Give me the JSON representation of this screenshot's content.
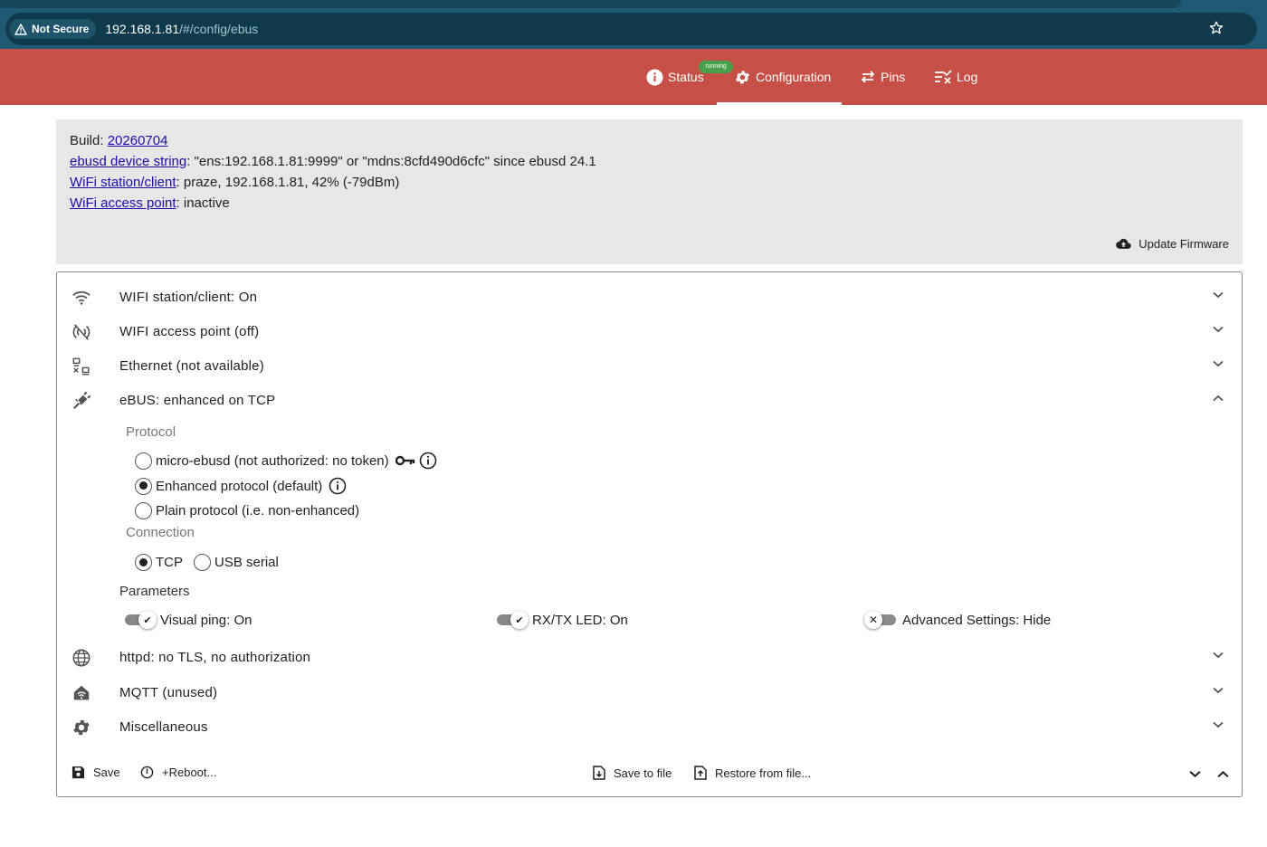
{
  "browser": {
    "not_secure": "Not Secure",
    "url_host": "192.168.1.81",
    "url_path": "/#/config/ebus"
  },
  "nav": {
    "status": "Status",
    "running_badge": "running",
    "configuration": "Configuration",
    "pins": "Pins",
    "log": "Log"
  },
  "info": {
    "build_label": "Build: ",
    "build_link": "20260704",
    "device_link": "ebusd device string",
    "device_text": ": \"ens:192.168.1.81:9999\" or \"mdns:8cfd490d6cfc\" since ebusd 24.1",
    "wifi_sta_link": "WiFi station/client",
    "wifi_sta_text": ": praze, 192.168.1.81, 42% (-79dBm)",
    "wifi_ap_link": "WiFi access point",
    "wifi_ap_text": ": inactive",
    "update_firmware": "Update Firmware"
  },
  "sections": {
    "wifi_station": "WIFI station/client: On",
    "wifi_ap": "WIFI access point (off)",
    "ethernet": "Ethernet (not available)",
    "ebus": "eBUS: enhanced on TCP",
    "httpd": "httpd: no TLS, no authorization",
    "mqtt": "MQTT (unused)",
    "misc": "Miscellaneous"
  },
  "ebus": {
    "protocol_heading": "Protocol",
    "protocol_options": [
      "micro-ebusd (not authorized: no token)",
      "Enhanced protocol (default)",
      "Plain protocol (i.e. non-enhanced)"
    ],
    "protocol_selected": 1,
    "connection_heading": "Connection",
    "connection_options": [
      "TCP",
      "USB serial"
    ],
    "connection_selected": 0,
    "parameters_heading": "Parameters",
    "visual_ping": "Visual ping: On",
    "rxtx_led": "RX/TX LED: On",
    "advanced": "Advanced Settings: Hide"
  },
  "footer": {
    "save": "Save",
    "reboot": "+Reboot...",
    "save_to_file": "Save to file",
    "restore": "Restore from file..."
  },
  "colors": {
    "header": "#c65047",
    "browser": "#1e5a73",
    "badge": "#49a04c"
  }
}
